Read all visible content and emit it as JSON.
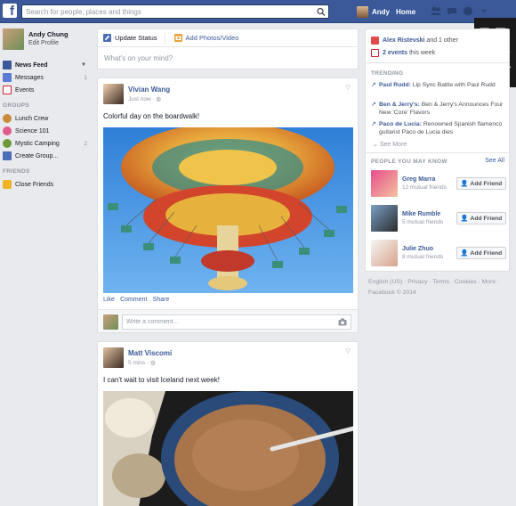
{
  "topbar": {
    "logo": "f",
    "search_placeholder": "Search for people, places and things",
    "user_name": "Andy",
    "home_label": "Home",
    "icons": [
      "friend-requests-icon",
      "messages-icon",
      "notifications-icon",
      "settings-icon"
    ]
  },
  "watermark": {
    "line1": "PR",
    "line2": "BK"
  },
  "left": {
    "profile": {
      "name": "Andy Chung",
      "edit_label": "Edit Profile"
    },
    "nav": [
      {
        "label": "News Feed",
        "count": ""
      },
      {
        "label": "Messages",
        "count": "1"
      },
      {
        "label": "Events",
        "count": ""
      }
    ],
    "groups_header": "GROUPS",
    "groups": [
      {
        "label": "Lunch Crew",
        "count": ""
      },
      {
        "label": "Science 101",
        "count": ""
      },
      {
        "label": "Mystic Camping",
        "count": "2"
      },
      {
        "label": "Create Group...",
        "count": ""
      }
    ],
    "friends_header": "FRIENDS",
    "friends": [
      {
        "label": "Close Friends"
      }
    ]
  },
  "composer": {
    "update_status": "Update Status",
    "add_photos": "Add Photos/Video",
    "prompt": "What's on your mind?"
  },
  "posts": [
    {
      "author": "Vivian Wang",
      "time": "Just now",
      "text": "Colorful day on the boardwalk!",
      "actions": {
        "like": "Like",
        "comment": "Comment",
        "share": "Share"
      },
      "comment_placeholder": "Write a comment..."
    },
    {
      "author": "Matt Viscomi",
      "time": "5 mins",
      "text": "I can't wait to visit Iceland next week!"
    }
  ],
  "right": {
    "events": [
      {
        "name": "Alex Ristevski",
        "rest": " and 1 other"
      },
      {
        "name": "2 events",
        "rest": " this week"
      }
    ],
    "trending_header": "TRENDING",
    "trending": [
      {
        "topic": "Paul Rudd:",
        "desc": " Lip Sync Battle with Paul Rudd"
      },
      {
        "topic": "Ben & Jerry's:",
        "desc": " Ben & Jerry's Announces Four New 'Core' Flavors"
      },
      {
        "topic": "Paco de Lucia:",
        "desc": " Renowned Spanish flamenco guitarist Paco de Lucia dies"
      }
    ],
    "see_more": "See More",
    "pymk_header": "PEOPLE YOU MAY KNOW",
    "see_all": "See All",
    "people": [
      {
        "name": "Greg Marra",
        "mutual": "12 mutual friends",
        "button": "Add Friend"
      },
      {
        "name": "Mike Rumble",
        "mutual": "5 mutual friends",
        "button": "Add Friend"
      },
      {
        "name": "Julie Zhuo",
        "mutual": "8 mutual friends",
        "button": "Add Friend"
      }
    ]
  },
  "footer": {
    "line1": "English (US) · Privacy · Terms · Cookies · More ·",
    "line2": "Facebook © 2014"
  },
  "colors": {
    "brand": "#3b5998",
    "background": "#e9eaed",
    "trend_arrow": "#3b5998"
  }
}
